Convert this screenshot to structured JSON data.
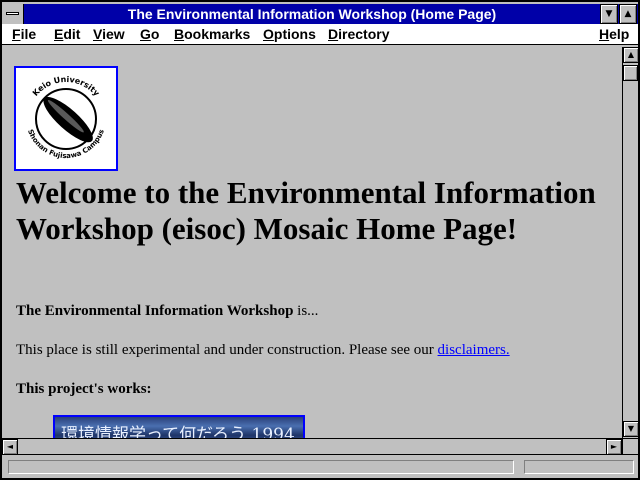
{
  "window": {
    "title": "The Environmental Information Workshop (Home Page)",
    "minimize_glyph": "▼",
    "maximize_glyph": "▲"
  },
  "menu": {
    "file": "File",
    "edit": "Edit",
    "view": "View",
    "go": "Go",
    "bookmarks": "Bookmarks",
    "options": "Options",
    "directory": "Directory",
    "help": "Help"
  },
  "page": {
    "logo": {
      "icon": "keio-university-sfc-seal",
      "ring_top": "Keio University",
      "ring_bottom": "Shonan Fujisawa Campus"
    },
    "heading": "Welcome to the Environmental Information Workshop (eisoc) Mosaic Home Page!",
    "intro_bold": "The Environmental Information Workshop",
    "intro_rest": " is...",
    "construction_text": "This place is still experimental and under construction. Please see our ",
    "disclaimers_link": "disclaimers.",
    "works_heading": "This project's works:",
    "banner_text": "環境情報学って何だろう 1994"
  },
  "scrollbars": {
    "up_glyph": "▲",
    "down_glyph": "▼",
    "left_glyph": "◄",
    "right_glyph": "►"
  },
  "status": {
    "text": ""
  },
  "colors": {
    "title_bar": "#0000a8",
    "link": "#0000ff",
    "background": "#c0c0c0"
  }
}
